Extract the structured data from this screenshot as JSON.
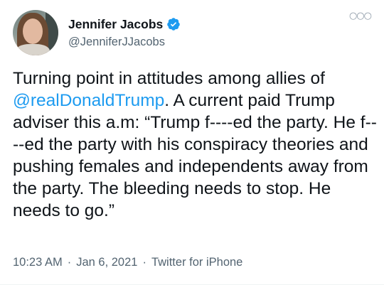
{
  "author": {
    "display_name": "Jennifer Jacobs",
    "handle": "@JenniferJJacobs",
    "verified": true
  },
  "tweet": {
    "text_1": "Turning point in attitudes among allies of ",
    "mention": "@realDonaldTrump",
    "text_2": ". A current paid Trump adviser this a.m: “Trump f----ed the party. He f----ed the party with his conspiracy theories and pushing females and independents away from the party. The bleeding needs to stop. He needs to go.”"
  },
  "meta": {
    "time": "10:23 AM",
    "separator_1": "·",
    "date": "Jan 6, 2021",
    "separator_2": "·",
    "source": "Twitter for iPhone"
  },
  "icons": {
    "more": "more-options-icon",
    "verified": "verified-badge-icon"
  },
  "colors": {
    "link": "#1d9bf0",
    "secondary_text": "#536471",
    "primary_text": "#0f1419",
    "verified": "#1d9bf0"
  }
}
